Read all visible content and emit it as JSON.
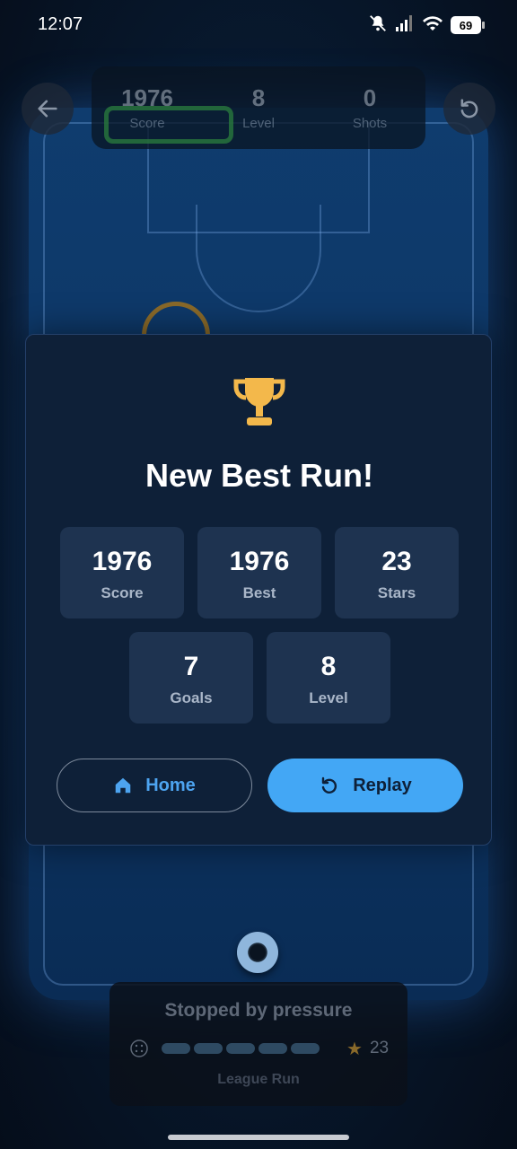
{
  "status_bar": {
    "time": "12:07",
    "battery": "69"
  },
  "top_bar": {
    "stats": [
      {
        "value": "1976",
        "label": "Score"
      },
      {
        "value": "8",
        "label": "Level"
      },
      {
        "value": "0",
        "label": "Shots"
      }
    ]
  },
  "modal": {
    "title": "New Best Run!",
    "stats": [
      {
        "value": "1976",
        "label": "Score"
      },
      {
        "value": "1976",
        "label": "Best"
      },
      {
        "value": "23",
        "label": "Stars"
      },
      {
        "value": "7",
        "label": "Goals"
      },
      {
        "value": "8",
        "label": "Level"
      }
    ],
    "home_label": "Home",
    "replay_label": "Replay"
  },
  "bottom_panel": {
    "title": "Stopped by pressure",
    "stars": "23",
    "subtitle": "League Run"
  },
  "colors": {
    "accent": "#43a7f5",
    "trophy": "#f3b84b",
    "modal_bg": "#0e2038",
    "card_bg": "#1e3350"
  }
}
